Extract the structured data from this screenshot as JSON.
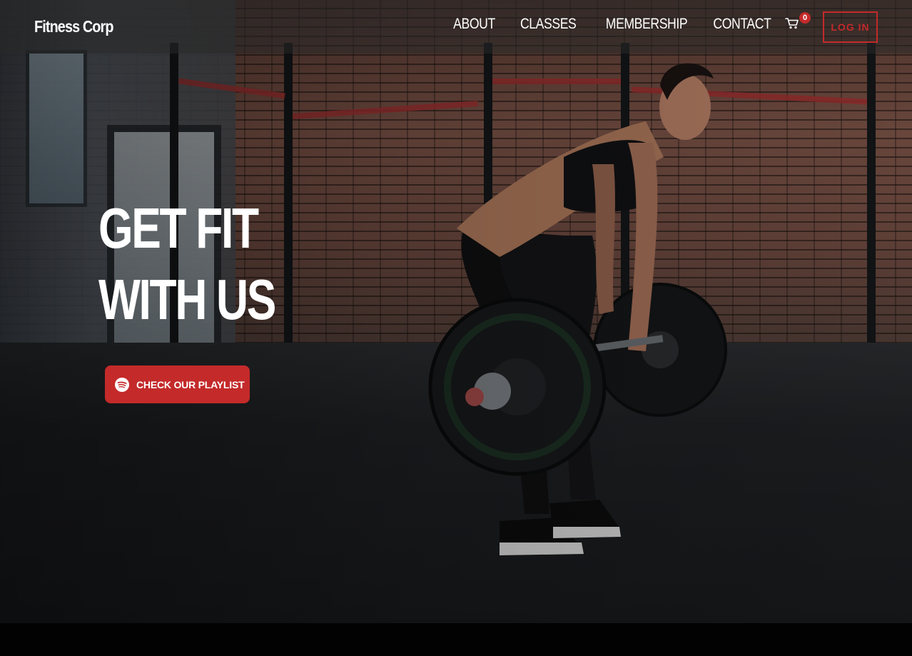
{
  "header": {
    "brand": "Fitness Corp",
    "nav": [
      {
        "label": "ABOUT"
      },
      {
        "label": "CLASSES"
      },
      {
        "label": "MEMBERSHIP"
      },
      {
        "label": "CONTACT"
      }
    ],
    "cart": {
      "icon": "shopping-cart-icon",
      "count": "0"
    },
    "login_label": "LOG IN"
  },
  "hero": {
    "title_line1": "GET FIT",
    "title_line2": "WITH US",
    "cta": {
      "icon": "spotify-icon",
      "label": "CHECK OUR PLAYLIST"
    }
  },
  "colors": {
    "accent": "#c42a2a",
    "text": "#ffffff",
    "header_bg": "rgba(40,40,40,0.55)"
  }
}
